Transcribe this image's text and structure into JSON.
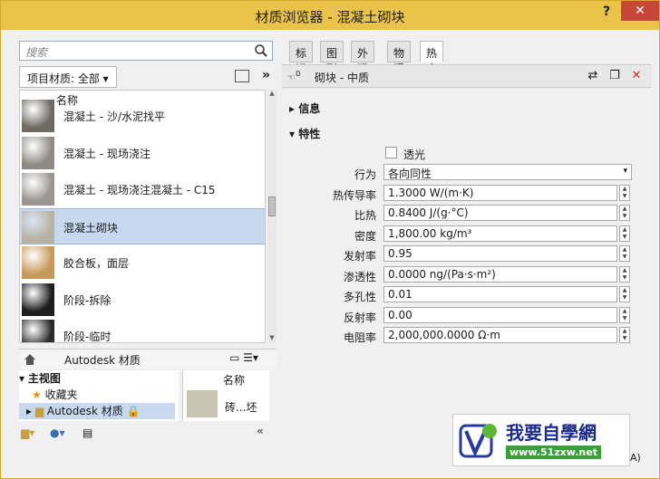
{
  "window": {
    "title": "材质浏览器 - 混凝土砌块",
    "help_label": "?",
    "close_label": "✕"
  },
  "left": {
    "search": {
      "placeholder": "搜索"
    },
    "library_filter": "项目材质: 全部",
    "column_name": "名称",
    "materials": [
      {
        "label": "混凝土 - 沙/水泥找平",
        "selected": false,
        "thumb": "#6f6a64"
      },
      {
        "label": "混凝土 - 现场浇注",
        "selected": false,
        "thumb": "#8e8a84"
      },
      {
        "label": "混凝土 - 现场浇注混凝土 - C15",
        "selected": false,
        "thumb": "#9a9590"
      },
      {
        "label": "混凝土砌块",
        "selected": true,
        "thumb": "#b8b2a4"
      },
      {
        "label": "胶合板，面层",
        "selected": false,
        "thumb": "#c89a5a"
      },
      {
        "label": "阶段-拆除",
        "selected": false,
        "thumb": "#1e1e1e"
      },
      {
        "label": "阶段-临时",
        "selected": false,
        "thumb": "#2a2a2a"
      }
    ],
    "nav_library": "Autodesk 材质",
    "tree": [
      {
        "label": "主视图",
        "selected": false
      },
      {
        "label": "收藏夹",
        "selected": false
      },
      {
        "label": "Autodesk 材质",
        "selected": true
      }
    ],
    "mini_column": "名称",
    "mini_item": "砖...坯"
  },
  "right": {
    "tabs": [
      "标识",
      "图形",
      "外观",
      "物理",
      "热度"
    ],
    "active_tab": "热度",
    "asset_count": "0",
    "asset_name": "砌块 - 中质",
    "sections": {
      "info": "信息",
      "props": "特性"
    },
    "transparent_label": "透光",
    "properties": [
      {
        "label": "行为",
        "value": "各向同性",
        "kind": "select"
      },
      {
        "label": "热传导率",
        "value": "1.3000 W/(m·K)",
        "kind": "spin"
      },
      {
        "label": "比热",
        "value": "0.8400 J/(g·°C)",
        "kind": "spin"
      },
      {
        "label": "密度",
        "value": "1,800.00 kg/m³",
        "kind": "spin"
      },
      {
        "label": "发射率",
        "value": "0.95",
        "kind": "spin"
      },
      {
        "label": "渗透性",
        "value": "0.0000 ng/(Pa·s·m²)",
        "kind": "spin"
      },
      {
        "label": "多孔性",
        "value": "0.01",
        "kind": "spin"
      },
      {
        "label": "反射率",
        "value": "0.00",
        "kind": "spin"
      },
      {
        "label": "电阻率",
        "value": "2,000,000.0000 Ω·m",
        "kind": "spin"
      }
    ]
  },
  "watermark": {
    "text": "我要自學網",
    "url": "www.51zxw.net"
  },
  "footer_fragment": "A)"
}
